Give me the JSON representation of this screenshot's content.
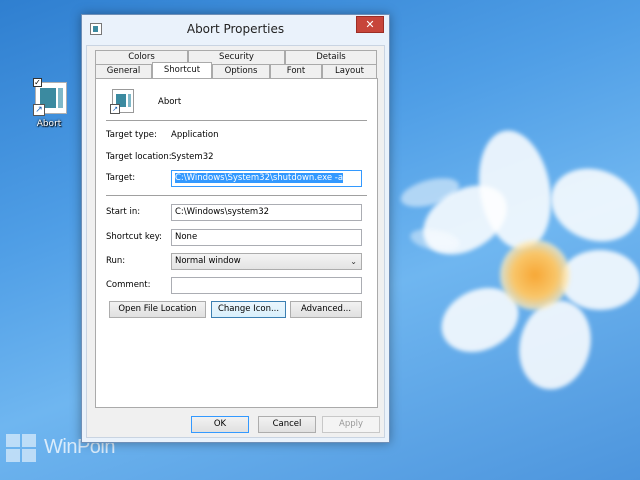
{
  "desktop": {
    "icon_label": "Abort",
    "watermark": "WinPoin"
  },
  "window": {
    "title": "Abort Properties",
    "close_glyph": "✕",
    "tabs_back": [
      "Colors",
      "Security",
      "Details"
    ],
    "tabs_front": [
      "General",
      "Shortcut",
      "Options",
      "Font",
      "Layout"
    ],
    "active_tab": "Shortcut",
    "shortcut_name": "Abort",
    "target_type_label": "Target type:",
    "target_type_value": "Application",
    "target_location_label": "Target location:",
    "target_location_value": "System32",
    "target_label": "Target:",
    "target_value": "C:\\Windows\\System32\\shutdown.exe -a",
    "start_in_label": "Start in:",
    "start_in_value": "C:\\Windows\\system32",
    "shortcut_key_label": "Shortcut key:",
    "shortcut_key_value": "None",
    "run_label": "Run:",
    "run_value": "Normal window",
    "comment_label": "Comment:",
    "comment_value": "",
    "buttons": {
      "open_file_location": "Open File Location",
      "change_icon": "Change Icon...",
      "advanced": "Advanced...",
      "ok": "OK",
      "cancel": "Cancel",
      "apply": "Apply"
    }
  },
  "colors": {
    "accent": "#3399ff",
    "close": "#c7453a"
  }
}
